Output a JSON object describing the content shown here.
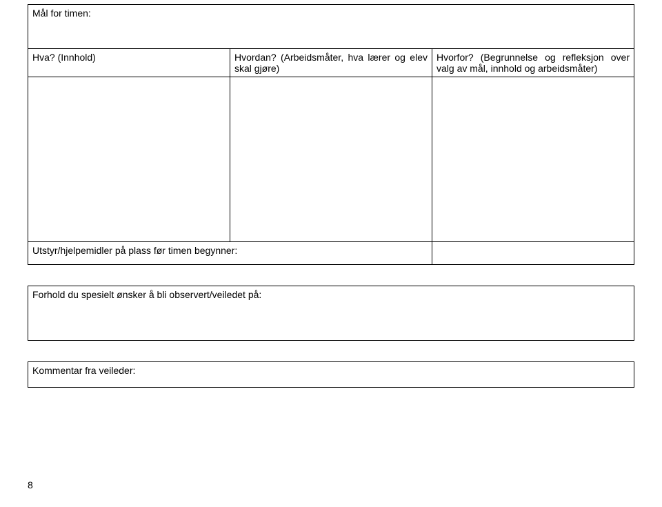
{
  "goalSection": {
    "title": "Mål for timen:"
  },
  "tableHeaders": {
    "col1": "Hva? (Innhold)",
    "col2": "Hvordan? (Arbeidsmåter, hva lærer og elev skal gjøre)",
    "col3": "Hvorfor? (Begrunnelse og refleksjon over valg av mål, innhold og arbeidsmåter)"
  },
  "rows": {
    "equipment": "Utstyr/hjelpemidler på plass før timen begynner:",
    "observation": "Forhold  du spesielt ønsker å bli observert/veiledet på:",
    "supervisor": "Kommentar fra veileder:"
  },
  "pageNumber": "8"
}
